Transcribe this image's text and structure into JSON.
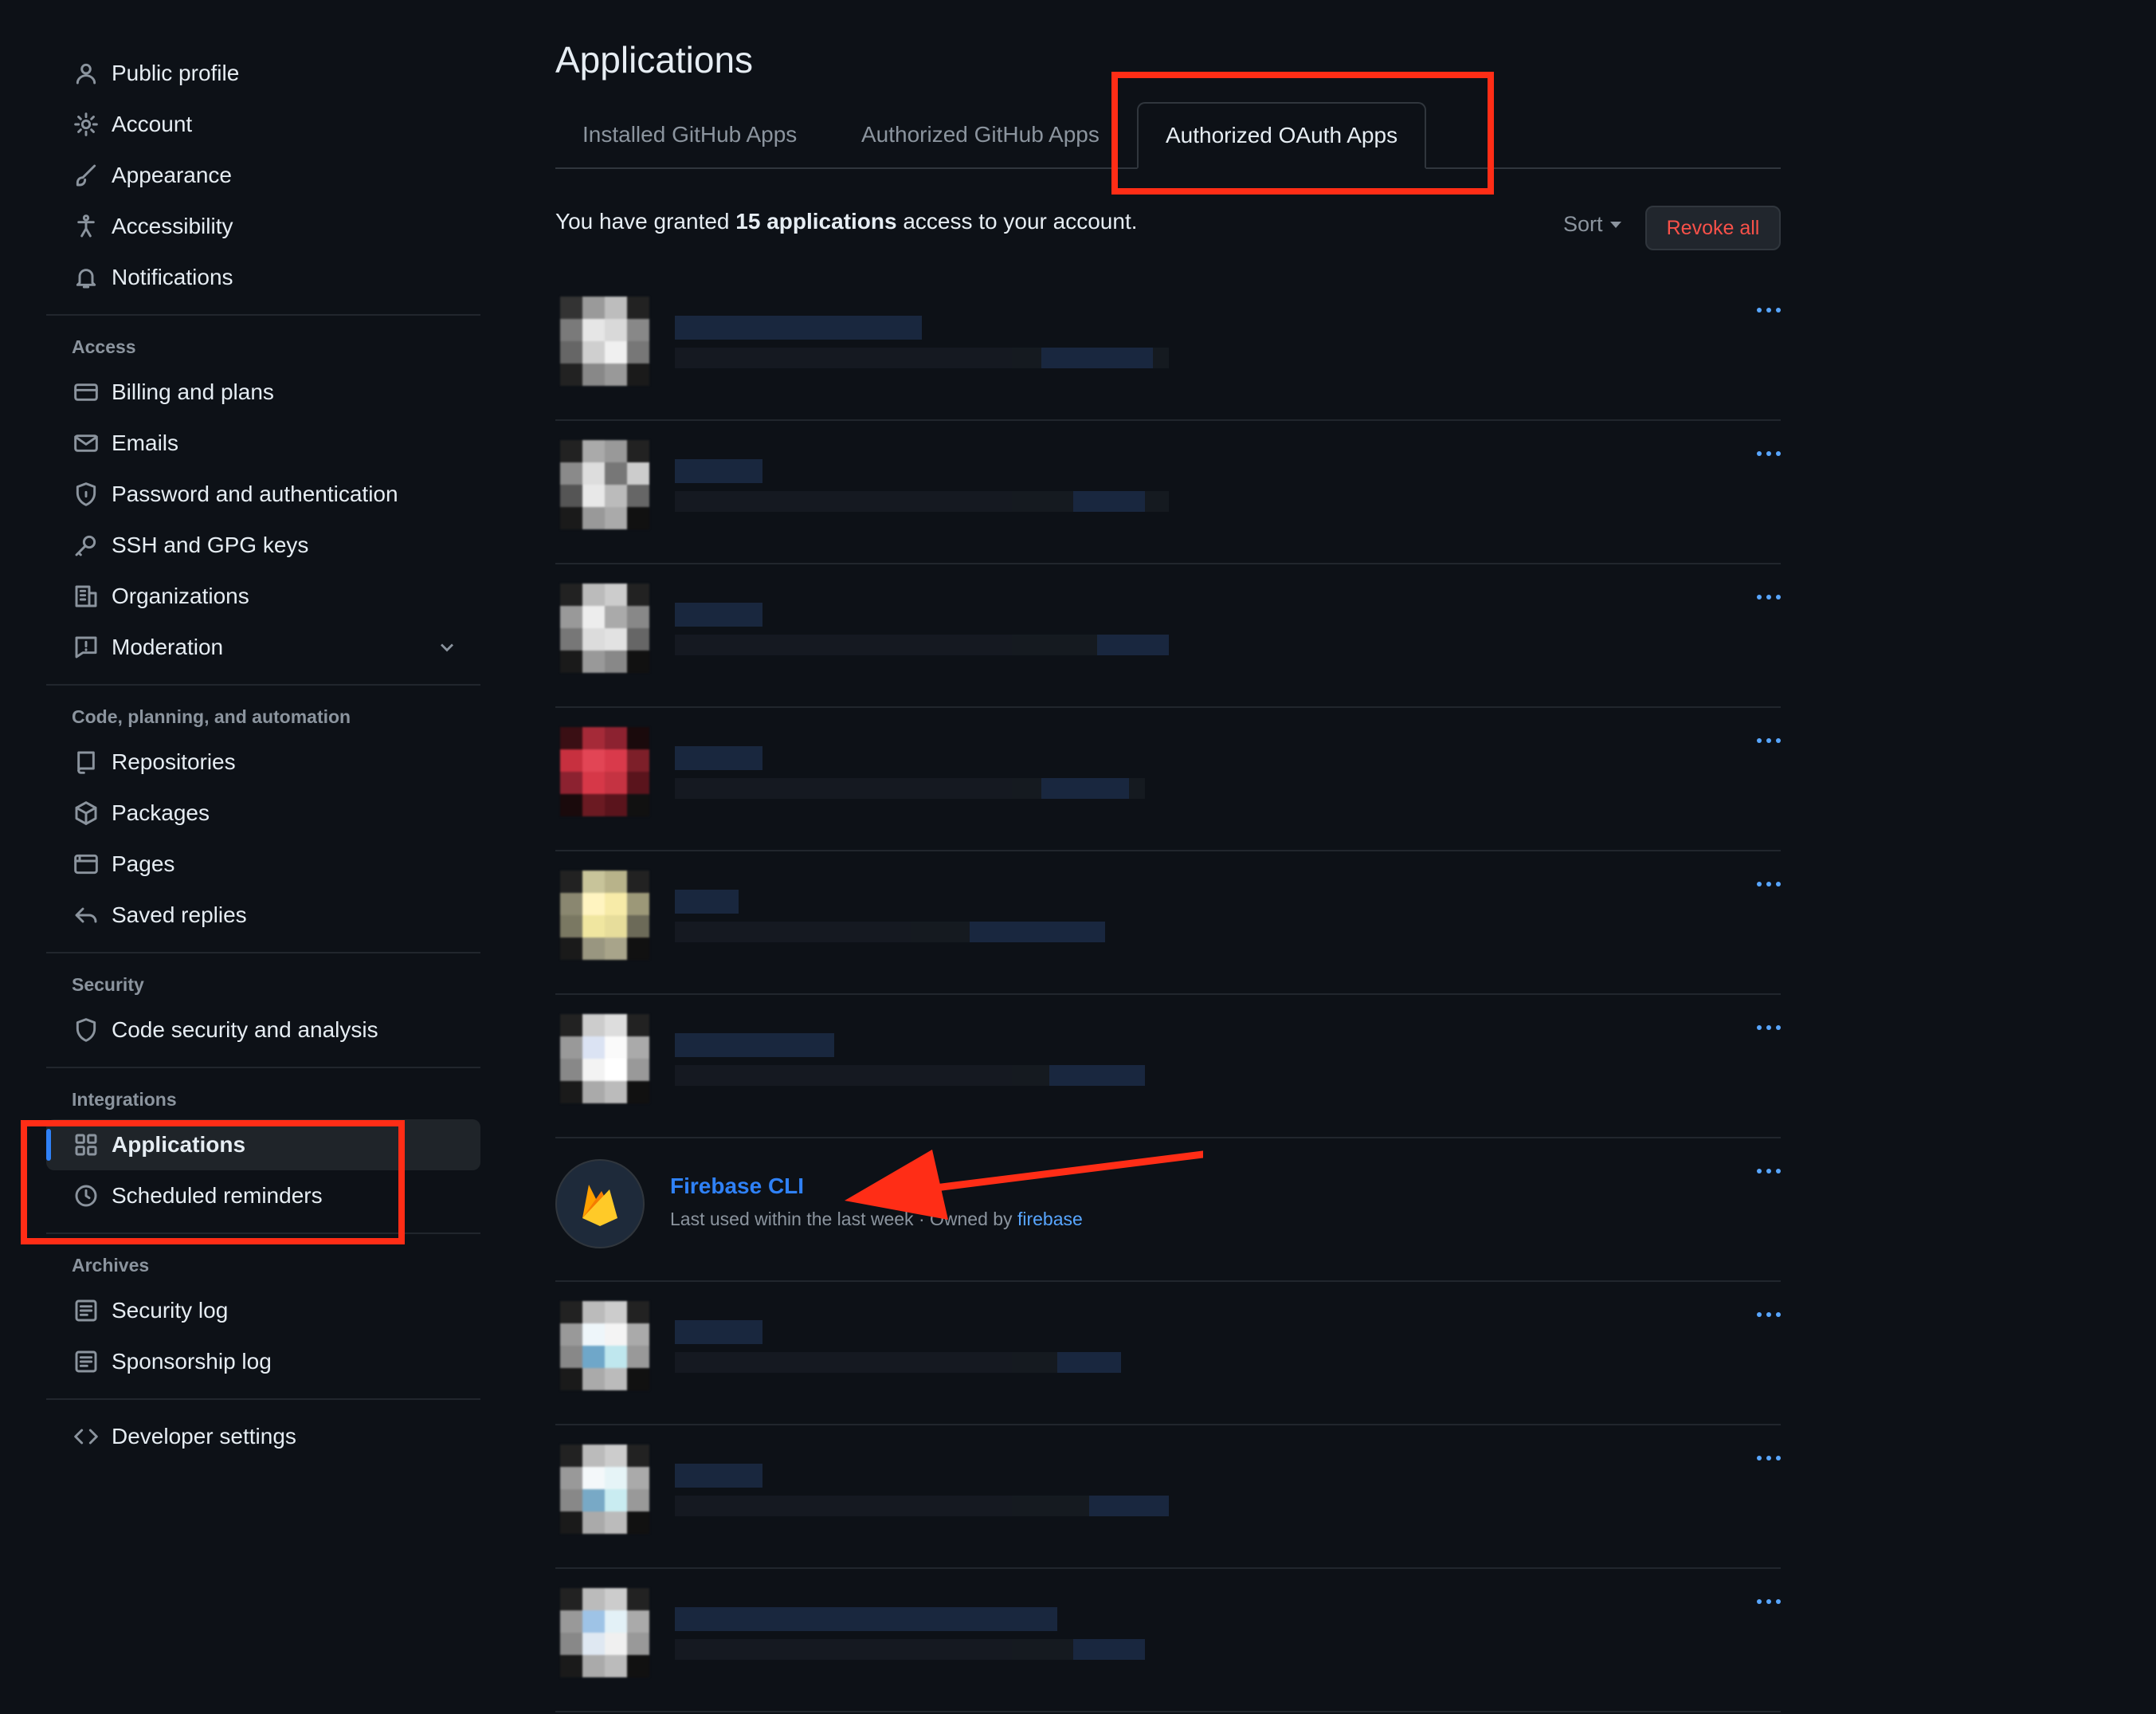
{
  "sidebar": {
    "top_items": [
      {
        "label": "Public profile",
        "icon": "person-icon"
      },
      {
        "label": "Account",
        "icon": "gear-icon"
      },
      {
        "label": "Appearance",
        "icon": "paintbrush-icon"
      },
      {
        "label": "Accessibility",
        "icon": "accessibility-icon"
      },
      {
        "label": "Notifications",
        "icon": "bell-icon"
      }
    ],
    "access_heading": "Access",
    "access_items": [
      {
        "label": "Billing and plans",
        "icon": "credit-card-icon"
      },
      {
        "label": "Emails",
        "icon": "mail-icon"
      },
      {
        "label": "Password and authentication",
        "icon": "shield-lock-icon"
      },
      {
        "label": "SSH and GPG keys",
        "icon": "key-icon"
      },
      {
        "label": "Organizations",
        "icon": "organization-icon"
      },
      {
        "label": "Moderation",
        "icon": "report-icon"
      }
    ],
    "code_heading": "Code, planning, and automation",
    "code_items": [
      {
        "label": "Repositories",
        "icon": "repo-icon"
      },
      {
        "label": "Packages",
        "icon": "package-icon"
      },
      {
        "label": "Pages",
        "icon": "browser-icon"
      },
      {
        "label": "Saved replies",
        "icon": "reply-icon"
      }
    ],
    "security_heading": "Security",
    "security_items": [
      {
        "label": "Code security and analysis",
        "icon": "shield-icon"
      }
    ],
    "integrations_heading": "Integrations",
    "integrations_items": [
      {
        "label": "Applications",
        "icon": "apps-icon",
        "active": true
      },
      {
        "label": "Scheduled reminders",
        "icon": "clock-icon"
      }
    ],
    "archives_heading": "Archives",
    "archives_items": [
      {
        "label": "Security log",
        "icon": "log-icon"
      },
      {
        "label": "Sponsorship log",
        "icon": "log-icon"
      }
    ],
    "developer_settings": {
      "label": "Developer settings",
      "icon": "code-icon"
    }
  },
  "main": {
    "title": "Applications",
    "tabs": [
      {
        "label": "Installed GitHub Apps"
      },
      {
        "label": "Authorized GitHub Apps"
      },
      {
        "label": "Authorized OAuth Apps",
        "selected": true
      }
    ],
    "summary_prefix": "You have granted ",
    "summary_count": "15 applications",
    "summary_suffix": " access to your account.",
    "sort_label": "Sort",
    "revoke_all_label": "Revoke all",
    "firebase": {
      "name": "Firebase CLI",
      "meta_prefix": "Last used within the last week · Owned by ",
      "owner": "firebase"
    }
  },
  "colors": {
    "background": "#0d1117",
    "accent": "#2f81f7",
    "link": "#58a6ff",
    "danger": "#f85149",
    "annotation": "#ff2d16"
  }
}
